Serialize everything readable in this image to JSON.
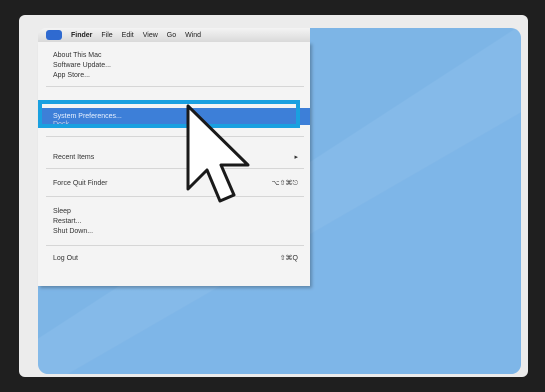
{
  "menubar": {
    "items": [
      "Finder",
      "File",
      "Edit",
      "View",
      "Go",
      "Wind"
    ]
  },
  "menu": {
    "about": "About This Mac",
    "software_update": "Software Update...",
    "app_store": "App Store...",
    "system_preferences": "System Preferences...",
    "dock": "Dock",
    "recent_items": "Recent Items",
    "recent_arrow": "▸",
    "force_quit": "Force Quit Finder",
    "force_quit_shortcut": "⌥⇧⌘⎋",
    "sleep": "Sleep",
    "restart": "Restart...",
    "shut_down": "Shut Down...",
    "log_out": "Log Out",
    "log_out_shortcut": "⇧⌘Q"
  },
  "colors": {
    "desktop": "#7db5e6",
    "selection": "#3d7fd8",
    "highlight_box": "#1aa0e0"
  }
}
